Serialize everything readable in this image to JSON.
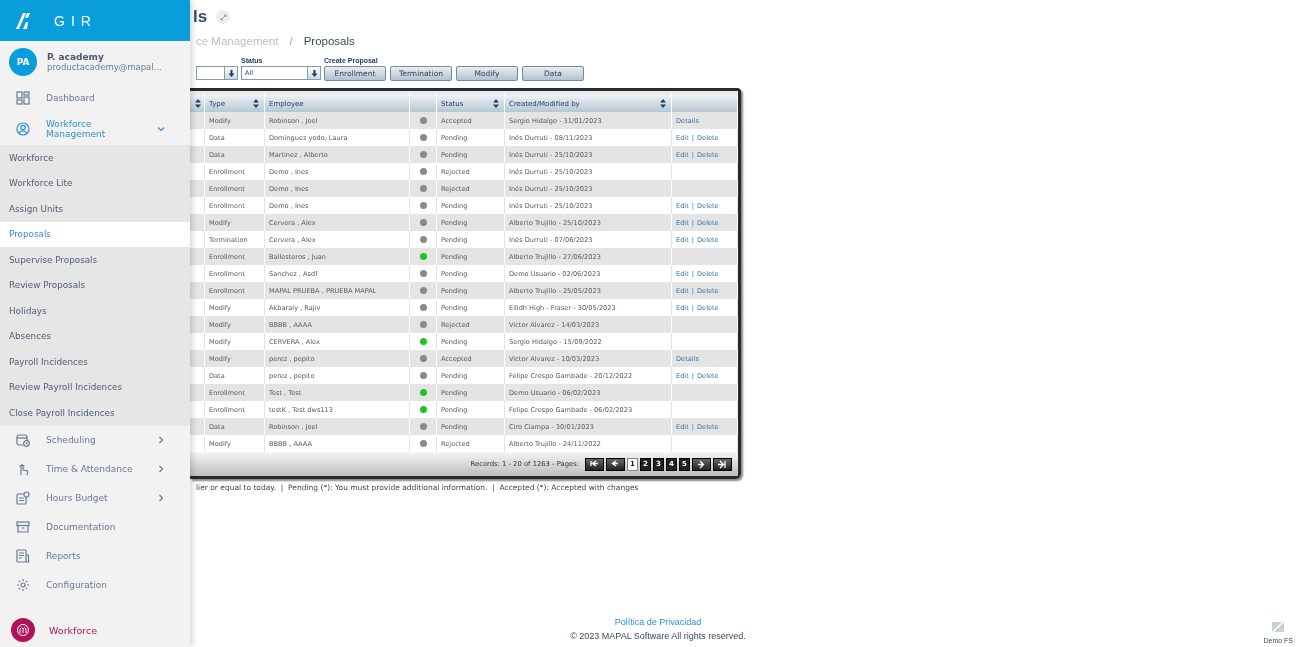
{
  "sidebar": {
    "logo": "GIR",
    "user": {
      "initials": "PA",
      "name": "P. academy",
      "email": "productacademy@mapal..."
    },
    "items": [
      {
        "kind": "link",
        "label": "Dashboard"
      },
      {
        "kind": "group",
        "label": "Workforce Management",
        "expanded": true,
        "children": [
          {
            "label": "Workforce",
            "selected": false
          },
          {
            "label": "Workforce Lite",
            "selected": false
          },
          {
            "label": "Assign Units",
            "selected": false
          },
          {
            "label": "Proposals",
            "selected": true
          },
          {
            "label": "Supervise Proposals",
            "selected": false
          },
          {
            "label": "Review Proposals",
            "selected": false
          },
          {
            "label": "Holidays",
            "selected": false
          },
          {
            "label": "Absences",
            "selected": false
          },
          {
            "label": "Payroll Incidences",
            "selected": false
          },
          {
            "label": "Review Payroll Incidences",
            "selected": false
          },
          {
            "label": "Close Payroll Incidences",
            "selected": false
          }
        ]
      },
      {
        "kind": "group",
        "label": "Scheduling",
        "expanded": false
      },
      {
        "kind": "group",
        "label": "Time & Attendance",
        "expanded": false
      },
      {
        "kind": "group",
        "label": "Hours Budget",
        "expanded": false
      },
      {
        "kind": "link",
        "label": "Documentation"
      },
      {
        "kind": "link",
        "label": "Reports"
      },
      {
        "kind": "link",
        "label": "Configuration"
      }
    ],
    "app": {
      "label": "Workforce"
    }
  },
  "page": {
    "title": "ls",
    "breadcrumb": [
      "ce Management",
      "/",
      "Proposals"
    ]
  },
  "filters": {
    "status": {
      "label": "Status",
      "value": "All"
    },
    "create_label": "Create Proposal",
    "create_buttons": [
      "Enrollment",
      "Termination",
      "Modify",
      "Data"
    ]
  },
  "table": {
    "columns": [
      {
        "kind": "sort",
        "sortable": true
      },
      {
        "label": "Type",
        "sortable": true
      },
      {
        "label": "Employee",
        "sortable": false
      },
      {
        "kind": "blank",
        "sortable": false
      },
      {
        "label": "Status",
        "sortable": true
      },
      {
        "label": "Created/Modified by",
        "sortable": true
      },
      {
        "kind": "blank",
        "sortable": false
      }
    ],
    "rows": [
      {
        "type": "Modify",
        "employee": "Robinson , Joel",
        "color": "#8a8a8a",
        "status": "Accepted",
        "created": "Sergio Hidalgo - 31/01/2023",
        "actions": [
          "Details"
        ]
      },
      {
        "type": "Data",
        "employee": "Dominguez yodo, Laura",
        "color": "#8a8a8a",
        "status": "Pending",
        "created": "Inés Durruti - 08/11/2023",
        "actions": [
          "Edit",
          "|",
          "Delete"
        ]
      },
      {
        "type": "Data",
        "employee": "Martinez , Alberto",
        "color": "#8a8a8a",
        "status": "Pending",
        "created": "Inés Durruti - 25/10/2023",
        "actions": [
          "Edit",
          "|",
          "Delete"
        ]
      },
      {
        "type": "Enrollment",
        "employee": "Demo , Ines",
        "color": "#8a8a8a",
        "status": "Rejected",
        "created": "Inés Durruti - 25/10/2023",
        "actions": []
      },
      {
        "type": "Enrollment",
        "employee": "Demo , Ines",
        "color": "#8a8a8a",
        "status": "Rejected",
        "created": "Inés Durruti - 25/10/2023",
        "actions": []
      },
      {
        "type": "Enrollment",
        "employee": "Demo , Ines",
        "color": "#8a8a8a",
        "status": "Pending",
        "created": "Inés Durruti - 25/10/2023",
        "actions": [
          "Edit",
          "|",
          "Delete"
        ]
      },
      {
        "type": "Modify",
        "employee": "Cervera , Alex",
        "color": "#8a8a8a",
        "status": "Pending",
        "created": "Alberto Trujillo - 25/10/2023",
        "actions": [
          "Edit",
          "|",
          "Delete"
        ]
      },
      {
        "type": "Termination",
        "employee": "Cervera , Alex",
        "color": "#8a8a8a",
        "status": "Pending",
        "created": "Inés Durruti - 07/06/2023",
        "actions": [
          "Edit",
          "|",
          "Delete"
        ]
      },
      {
        "type": "Enrollment",
        "employee": "Ballesteros , Juan",
        "color": "#1fc41f",
        "status": "Pending",
        "created": "Alberto Trujillo - 27/06/2023",
        "actions": []
      },
      {
        "type": "Enrollment",
        "employee": "Sanchez , Asdf",
        "color": "#8a8a8a",
        "status": "Pending",
        "created": "Demo Usuario - 02/06/2023",
        "actions": [
          "Edit",
          "|",
          "Delete"
        ]
      },
      {
        "type": "Enrollment",
        "employee": "MAPAL PRUEBA , PRUEBA MAPAL",
        "color": "#8a8a8a",
        "status": "Pending",
        "created": "Alberto Trujillo - 25/05/2023",
        "actions": [
          "Edit",
          "|",
          "Delete"
        ]
      },
      {
        "type": "Modify",
        "employee": "Akbaraly , Rajiv",
        "color": "#8a8a8a",
        "status": "Pending",
        "created": "Eilidh High - Fraser - 30/05/2023",
        "actions": [
          "Edit",
          "|",
          "Delete"
        ]
      },
      {
        "type": "Modify",
        "employee": "BBBB , AAAA",
        "color": "#8a8a8a",
        "status": "Rejected",
        "created": "Victor Alvarez - 14/03/2023",
        "actions": []
      },
      {
        "type": "Modify",
        "employee": "CERVERA , Alex",
        "color": "#1fc41f",
        "status": "Pending",
        "created": "Sergio Hidalgo - 15/09/2022",
        "actions": []
      },
      {
        "type": "Modify",
        "employee": "perez , pepito",
        "color": "#8a8a8a",
        "status": "Accepted",
        "created": "Victor Alvarez - 10/03/2023",
        "actions": [
          "Details"
        ]
      },
      {
        "type": "Data",
        "employee": "perez , pepito",
        "color": "#8a8a8a",
        "status": "Pending",
        "created": "Felipe Crespo Gambade - 20/12/2022",
        "actions": [
          "Edit",
          "|",
          "Delete"
        ]
      },
      {
        "type": "Enrollment",
        "employee": "Test , Test",
        "color": "#1fc41f",
        "status": "Pending",
        "created": "Demo Usuario - 06/02/2023",
        "actions": []
      },
      {
        "type": "Enrollment",
        "employee": "testK , Test dws113",
        "color": "#1fc41f",
        "status": "Pending",
        "created": "Felipe Crespo Gambade - 06/02/2023",
        "actions": []
      },
      {
        "type": "Data",
        "employee": "Robinson , Joel",
        "color": "#8a8a8a",
        "status": "Pending",
        "created": "Ciro Ciampa - 30/01/2023",
        "actions": [
          "Edit",
          "|",
          "Delete"
        ]
      },
      {
        "type": "Modify",
        "employee": "BBBB , AAAA",
        "color": "#8a8a8a",
        "status": "Rejected",
        "created": "Alberto Trujillo - 24/11/2022",
        "actions": []
      }
    ],
    "records": "Records: 1 - 20 of 1263 - Pages:",
    "pages": [
      {
        "label": "1",
        "selected": true
      },
      {
        "label": "2",
        "selected": false
      },
      {
        "label": "3",
        "selected": false
      },
      {
        "label": "4",
        "selected": false
      },
      {
        "label": "5",
        "selected": false
      }
    ]
  },
  "legend": "lier or equal to today.  |  Pending (*): You must provide additional information.  |  Accepted (*): Accepted with changes",
  "footer": {
    "link": "Política de Privacidad",
    "copyright": "© 2023 MAPAL Software All rights reserved.",
    "user": "Demo FS"
  }
}
